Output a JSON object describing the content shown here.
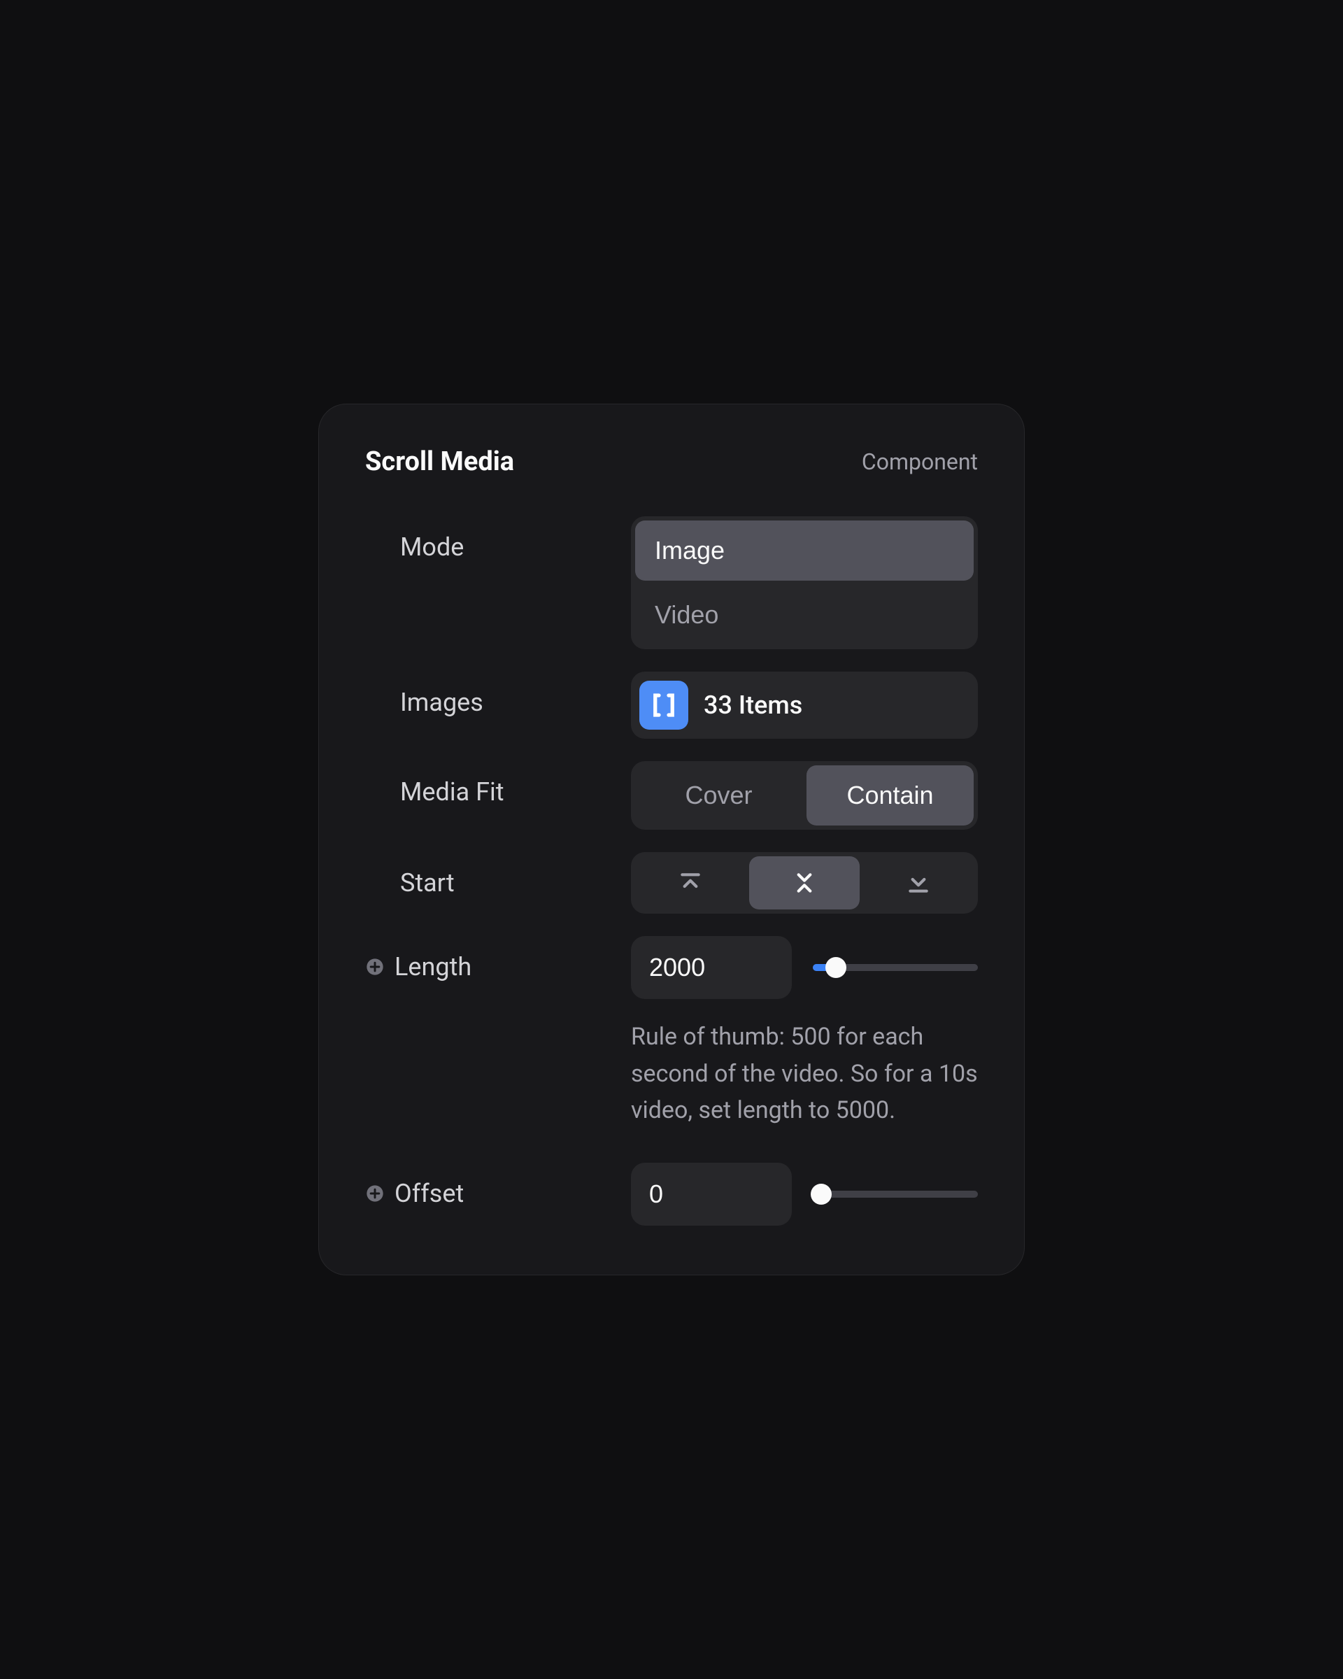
{
  "header": {
    "title": "Scroll Media",
    "subtitle": "Component"
  },
  "mode": {
    "label": "Mode",
    "options": [
      "Image",
      "Video"
    ],
    "selected": "Image"
  },
  "images": {
    "label": "Images",
    "text": "33 Items"
  },
  "mediaFit": {
    "label": "Media Fit",
    "options": [
      "Cover",
      "Contain"
    ],
    "selected": "Contain"
  },
  "start": {
    "label": "Start",
    "selected": 1
  },
  "length": {
    "label": "Length",
    "value": "2000",
    "sliderPercent": 14,
    "help": "Rule of thumb: 500 for each second of the video. So for a 10s video, set length to 5000."
  },
  "offset": {
    "label": "Offset",
    "value": "0",
    "sliderPercent": 5
  }
}
